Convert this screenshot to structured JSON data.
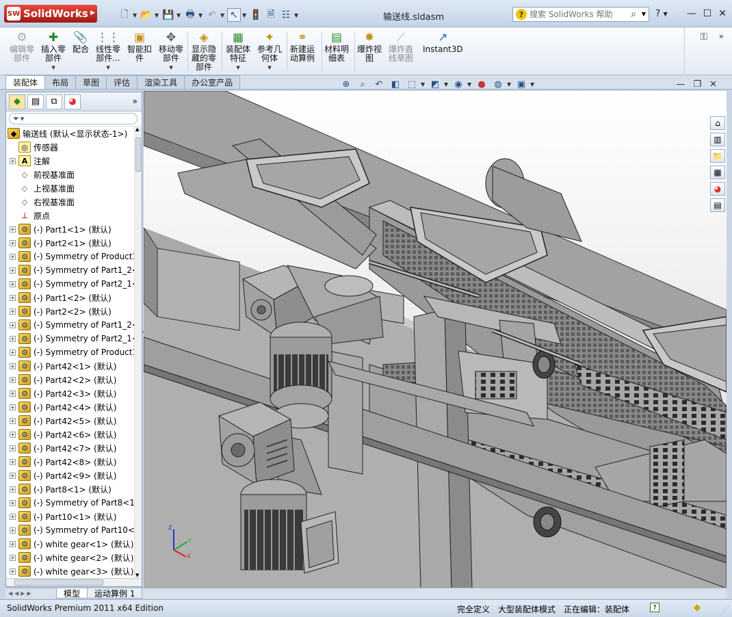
{
  "app": {
    "brand": "SolidWorks",
    "logo_mark": "SW",
    "document_title": "输送线.sldasm"
  },
  "help_search": {
    "placeholder": "搜索 SolidWorks 帮助"
  },
  "ribbon": {
    "buttons": [
      {
        "label": "编辑零\n部件",
        "icon": "edit-component-icon"
      },
      {
        "label": "插入零\n部件",
        "icon": "insert-component-icon"
      },
      {
        "label": "配合",
        "icon": "mate-icon"
      },
      {
        "label": "线性零\n部件...",
        "icon": "linear-pattern-icon"
      },
      {
        "label": "智能扣\n件",
        "icon": "smart-fastener-icon"
      },
      {
        "label": "移动零\n部件",
        "icon": "move-component-icon"
      },
      {
        "label": "显示隐\n藏的零\n部件",
        "icon": "show-hidden-icon"
      },
      {
        "label": "装配体\n特征",
        "icon": "assembly-feature-icon"
      },
      {
        "label": "参考几\n何体",
        "icon": "reference-geometry-icon"
      },
      {
        "label": "新建运\n动算例",
        "icon": "motion-study-icon"
      },
      {
        "label": "材料明\n细表",
        "icon": "bom-icon"
      },
      {
        "label": "爆炸视\n图",
        "icon": "exploded-view-icon"
      },
      {
        "label": "爆炸直\n线草图",
        "icon": "explode-line-icon"
      },
      {
        "label": "Instant3D",
        "icon": "instant3d-icon"
      }
    ]
  },
  "tabs": [
    "装配体",
    "布局",
    "草图",
    "评估",
    "渲染工具",
    "办公室产品"
  ],
  "feature_tree": {
    "root": "输送线  (默认<显示状态-1>)",
    "items": [
      "传感器",
      "注解",
      "前视基准面",
      "上视基准面",
      "右视基准面",
      "原点",
      "(-) Part1<1> (默认)",
      "(-) Part2<1> (默认)",
      "(-) Symmetry of Product1",
      "(-) Symmetry of Part1_2<",
      "(-) Symmetry of Part2_1<",
      "(-) Part1<2> (默认)",
      "(-) Part2<2> (默认)",
      "(-) Symmetry of Part1_2<",
      "(-) Symmetry of Part2_1<",
      "(-) Symmetry of Product1",
      "(-) Part42<1> (默认)",
      "(-) Part42<2> (默认)",
      "(-) Part42<3> (默认)",
      "(-) Part42<4> (默认)",
      "(-) Part42<5> (默认)",
      "(-) Part42<6> (默认)",
      "(-) Part42<7> (默认)",
      "(-) Part42<8> (默认)",
      "(-) Part42<9> (默认)",
      "(-) Part8<1> (默认)",
      "(-) Symmetry of Part8<1",
      "(-) Part10<1> (默认)",
      "(-) Symmetry of Part10<",
      "(-) white gear<1> (默认)",
      "(-) white gear<2> (默认)",
      "(-) white gear<3> (默认)"
    ]
  },
  "bottom_tabs": [
    "模型",
    "运动算例 1"
  ],
  "status": {
    "edition": "SolidWorks Premium 2011 x64 Edition",
    "defined": "完全定义",
    "mode": "大型装配体模式",
    "editing": "正在编辑：装配体"
  },
  "colors": {
    "logo_red": "#c0281c",
    "viewport_bg": "#e9e9e9",
    "model_gray": "#9b9b9b",
    "highlight_yellow": "#ffe7a3"
  }
}
